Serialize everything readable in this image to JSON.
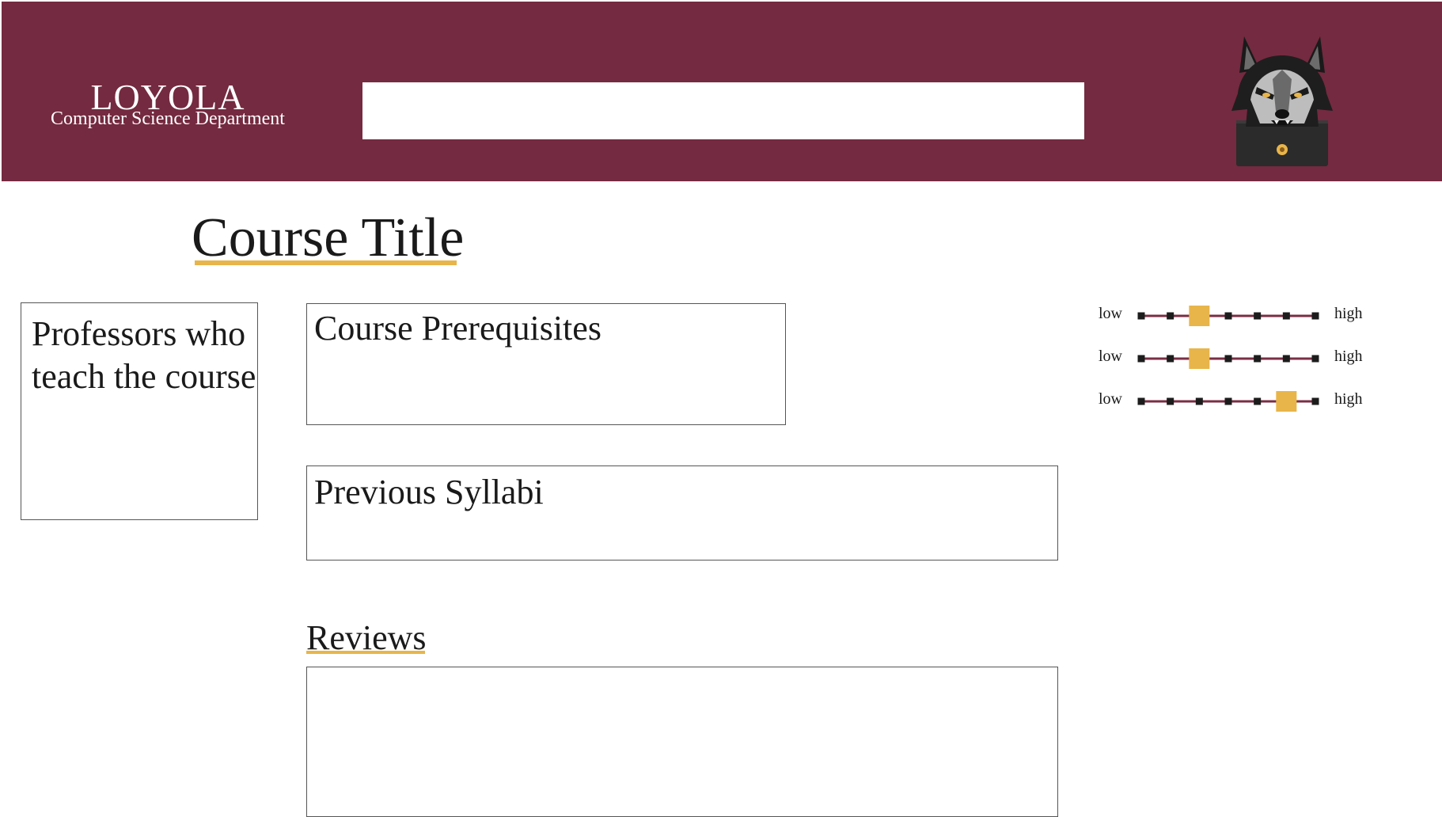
{
  "header": {
    "brand_name": "LOYOLA",
    "brand_subtitle": "Computer Science Department",
    "search": {
      "value": "",
      "placeholder": ""
    },
    "mascot_icon": "wolf-mascot-icon",
    "background_color": "#742a40"
  },
  "course": {
    "title": "Course Title",
    "professors_label": "Professors who teach the course",
    "prerequisites_label": "Course Prerequisites",
    "syllabi_label": "Previous Syllabi",
    "reviews_label": "Reviews"
  },
  "ratings": [
    {
      "low_label": "low",
      "high_label": "high",
      "steps": 7,
      "selected_index": 2
    },
    {
      "low_label": "low",
      "high_label": "high",
      "steps": 7,
      "selected_index": 2
    },
    {
      "low_label": "low",
      "high_label": "high",
      "steps": 7,
      "selected_index": 5
    }
  ],
  "colors": {
    "maroon": "#742a40",
    "gold": "#e8b54a",
    "track_line": "#7a2e45",
    "step_marker": "#1c1c1c"
  }
}
